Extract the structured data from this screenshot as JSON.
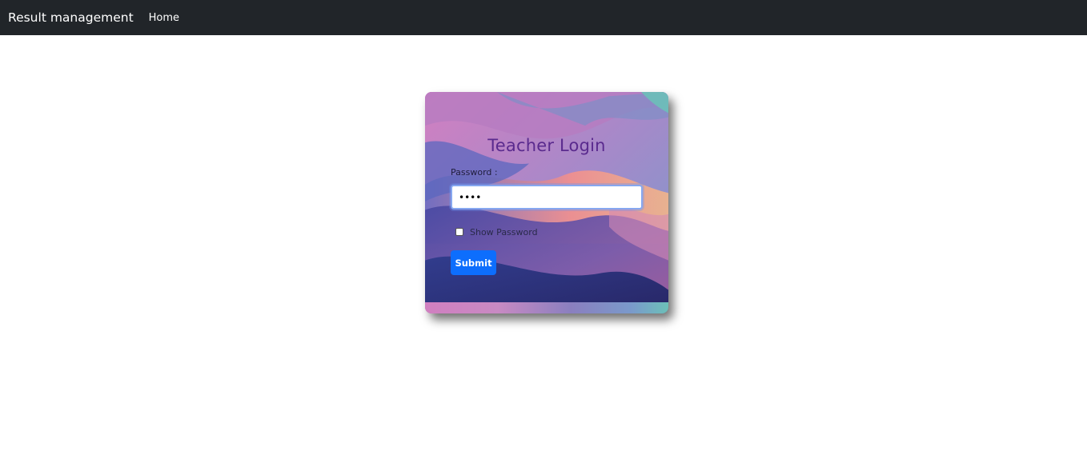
{
  "navbar": {
    "brand": "Result management",
    "links": [
      {
        "label": "Home"
      }
    ]
  },
  "login": {
    "title": "Teacher Login",
    "password_label": "Password :",
    "password_value": "••••",
    "show_password_label": "Show Password",
    "show_password_checked": false,
    "submit_label": "Submit"
  },
  "colors": {
    "navbar_bg": "#212529",
    "submit_bg": "#0d6efd",
    "title_color": "#5a2a8e"
  }
}
